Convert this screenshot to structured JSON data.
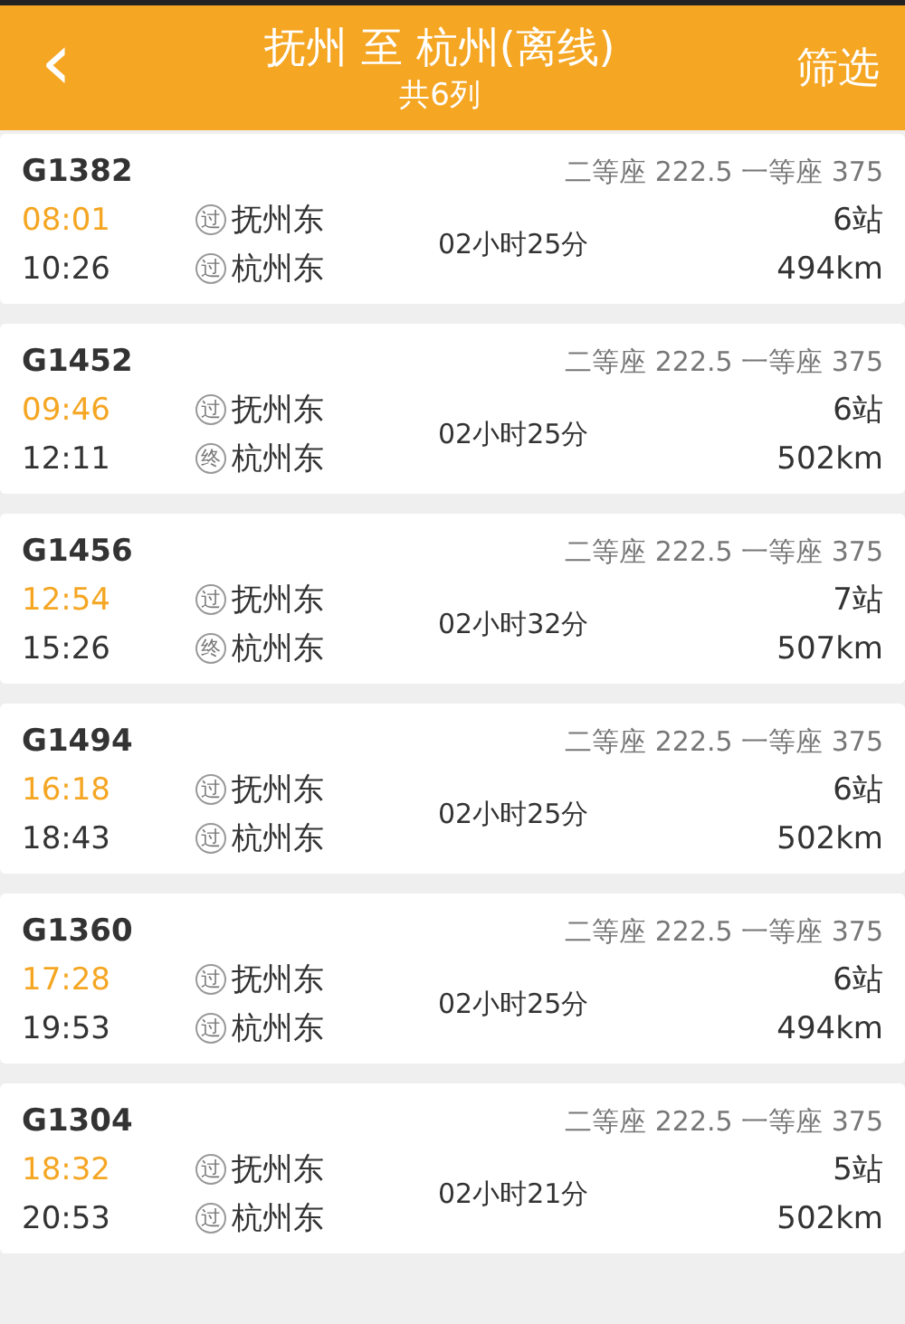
{
  "header": {
    "back_icon": "‹",
    "title": "抚州 至 杭州(离线)",
    "subtitle": "共6列",
    "filter": "筛选"
  },
  "trains": [
    {
      "number": "G1382",
      "prices": "二等座 222.5 一等座 375",
      "depart": "08:01",
      "arrive": "10:26",
      "from_badge": "过",
      "from": "抚州东",
      "to_badge": "过",
      "to": "杭州东",
      "duration": "02小时25分",
      "stops": "6站",
      "distance": "494km"
    },
    {
      "number": "G1452",
      "prices": "二等座 222.5 一等座 375",
      "depart": "09:46",
      "arrive": "12:11",
      "from_badge": "过",
      "from": "抚州东",
      "to_badge": "终",
      "to": "杭州东",
      "duration": "02小时25分",
      "stops": "6站",
      "distance": "502km"
    },
    {
      "number": "G1456",
      "prices": "二等座 222.5 一等座 375",
      "depart": "12:54",
      "arrive": "15:26",
      "from_badge": "过",
      "from": "抚州东",
      "to_badge": "终",
      "to": "杭州东",
      "duration": "02小时32分",
      "stops": "7站",
      "distance": "507km"
    },
    {
      "number": "G1494",
      "prices": "二等座 222.5 一等座 375",
      "depart": "16:18",
      "arrive": "18:43",
      "from_badge": "过",
      "from": "抚州东",
      "to_badge": "过",
      "to": "杭州东",
      "duration": "02小时25分",
      "stops": "6站",
      "distance": "502km"
    },
    {
      "number": "G1360",
      "prices": "二等座 222.5 一等座 375",
      "depart": "17:28",
      "arrive": "19:53",
      "from_badge": "过",
      "from": "抚州东",
      "to_badge": "过",
      "to": "杭州东",
      "duration": "02小时25分",
      "stops": "6站",
      "distance": "494km"
    },
    {
      "number": "G1304",
      "prices": "二等座 222.5 一等座 375",
      "depart": "18:32",
      "arrive": "20:53",
      "from_badge": "过",
      "from": "抚州东",
      "to_badge": "过",
      "to": "杭州东",
      "duration": "02小时21分",
      "stops": "5站",
      "distance": "502km"
    }
  ]
}
